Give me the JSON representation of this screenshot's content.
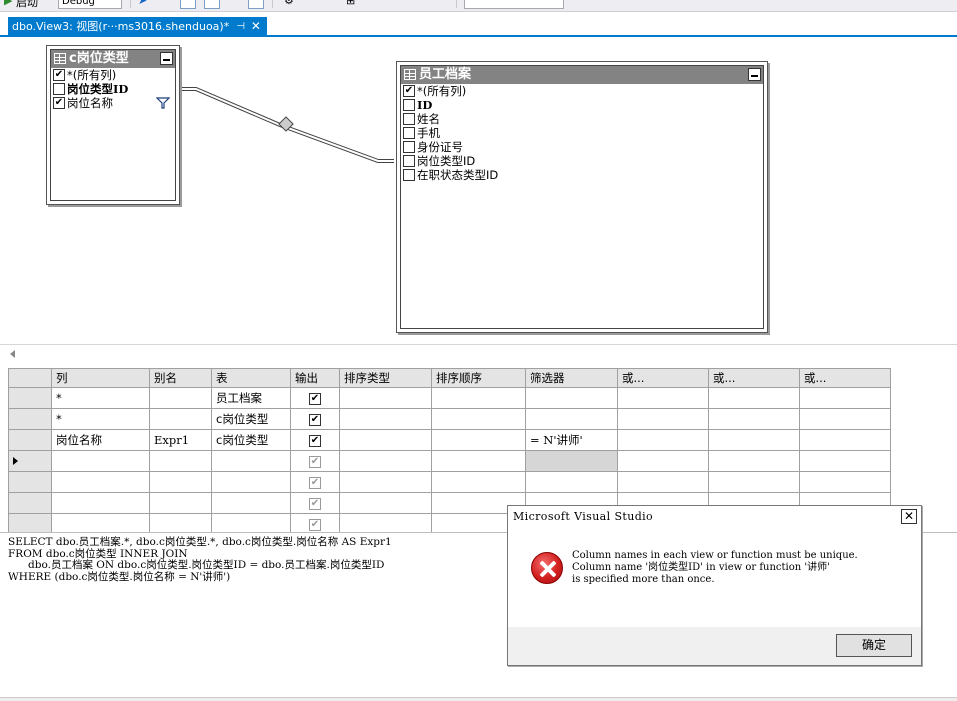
{
  "toolbar": {
    "start_label": "启动",
    "config_value": "Debug"
  },
  "tab": {
    "label": "dbo.View3: 视图(r···ms3016.shenduoa)*",
    "pin": "⊣",
    "close": "✕"
  },
  "diagram": {
    "table1": {
      "title": "c岗位类型",
      "columns": [
        {
          "label": "*(所有列)",
          "checked": "✔"
        },
        {
          "label": "岗位类型ID",
          "checked": ""
        },
        {
          "label": "岗位名称",
          "checked": "✔"
        }
      ]
    },
    "table2": {
      "title": "员工档案",
      "columns": [
        {
          "label": "*(所有列)",
          "checked": "✔"
        },
        {
          "label": "ID",
          "checked": ""
        },
        {
          "label": "姓名",
          "checked": ""
        },
        {
          "label": "手机",
          "checked": ""
        },
        {
          "label": "身份证号",
          "checked": ""
        },
        {
          "label": "岗位类型ID",
          "checked": ""
        },
        {
          "label": "在职状态类型ID",
          "checked": ""
        }
      ]
    }
  },
  "grid": {
    "headers": [
      "列",
      "别名",
      "表",
      "输出",
      "排序类型",
      "排序顺序",
      "筛选器",
      "或...",
      "或...",
      "或..."
    ],
    "rows": [
      {
        "col": "*",
        "alias": "",
        "table": "员工档案",
        "output": "✔",
        "filter": ""
      },
      {
        "col": "*",
        "alias": "",
        "table": "c岗位类型",
        "output": "✔",
        "filter": ""
      },
      {
        "col": "岗位名称",
        "alias": "Expr1",
        "table": "c岗位类型",
        "output": "✔",
        "filter": "= N'讲师'"
      },
      {
        "col": "",
        "alias": "",
        "table": "",
        "output": "✔",
        "filter": ""
      },
      {
        "col": "",
        "alias": "",
        "table": "",
        "output": "✔",
        "filter": ""
      },
      {
        "col": "",
        "alias": "",
        "table": "",
        "output": "✔",
        "filter": ""
      },
      {
        "col": "",
        "alias": "",
        "table": "",
        "output": "✔",
        "filter": ""
      }
    ]
  },
  "sql": {
    "lines": [
      "SELECT dbo.员工档案.*, dbo.c岗位类型.*, dbo.c岗位类型.岗位名称 AS Expr1",
      "FROM dbo.c岗位类型 INNER JOIN",
      "      dbo.员工档案 ON dbo.c岗位类型.岗位类型ID = dbo.员工档案.岗位类型ID",
      "WHERE (dbo.c岗位类型.岗位名称 = N'讲师')"
    ]
  },
  "dialog": {
    "title": "Microsoft Visual Studio",
    "close": "✕",
    "message_lines": [
      "Column names in each view or function must be unique.",
      "Column name '岗位类型ID' in view or function '讲师'",
      "is specified more than once."
    ],
    "ok_label": "确定"
  }
}
